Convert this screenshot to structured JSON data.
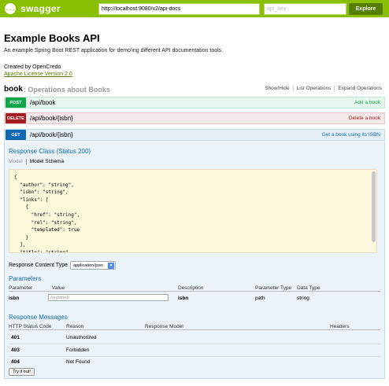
{
  "header": {
    "logo_glyph": "{...}",
    "logo_text": "swagger",
    "url_value": "http://localhost:9080/v2/api-docs",
    "api_key_placeholder": "api_key",
    "explore_label": "Explore",
    "bg_color": "#89bf04"
  },
  "info": {
    "title": "Example Books API",
    "description": "An example Spring Boot REST application for demo'ing different API documentation tools.",
    "created_by": "Created by OpenCredo",
    "license": "Apache License Version 2.0"
  },
  "resource": {
    "name": "book",
    "separator_desc": ": Operations about Books",
    "links": [
      "Show/Hide",
      "List Operations",
      "Expand Operations"
    ]
  },
  "operations": [
    {
      "method": "POST",
      "path": "/api/book",
      "summary": "Add a book",
      "color": "#10a54a"
    },
    {
      "method": "DELETE",
      "path": "/api/book/{isbn}",
      "summary": "Delete a book",
      "color": "#a41e22"
    },
    {
      "method": "GET",
      "path": "/api/book/{isbn}",
      "summary": "Get a book using its ISBN",
      "color": "#0f6ab4"
    }
  ],
  "expanded": {
    "response_class_title": "Response Class (Status 200)",
    "model_tab": "Model",
    "model_schema_tab": "Model Schema",
    "schema_text": "{\n  \"author\": \"string\",\n  \"isbn\": \"string\",\n  \"links\": [\n    {\n      \"href\": \"string\",\n      \"rel\": \"string\",\n      \"templated\": true\n    }\n  ],\n  \"title\": \"string\"",
    "response_content_type_label": "Response Content Type",
    "response_content_type_value": "application/json",
    "parameters_title": "Parameters",
    "param_headers": [
      "Parameter",
      "Value",
      "Description",
      "Parameter Type",
      "Data Type"
    ],
    "params": [
      {
        "name": "isbn",
        "value_placeholder": "(required)",
        "description": "isbn",
        "param_type": "path",
        "data_type": "string"
      }
    ],
    "response_messages_title": "Response Messages",
    "msg_headers": [
      "HTTP Status Code",
      "Reason",
      "Response Model",
      "Headers"
    ],
    "messages": [
      {
        "code": "401",
        "reason": "Unauthorized"
      },
      {
        "code": "403",
        "reason": "Forbidden"
      },
      {
        "code": "404",
        "reason": "Not Found"
      }
    ],
    "try_label": "Try it out!"
  }
}
